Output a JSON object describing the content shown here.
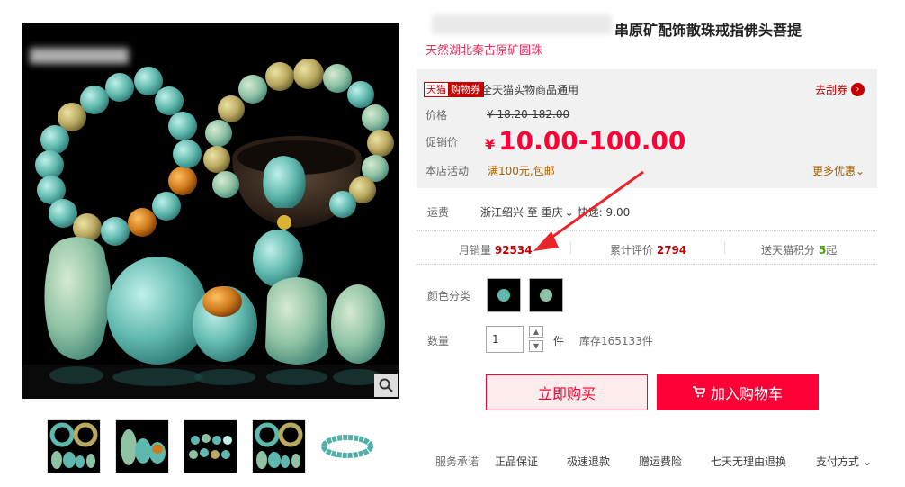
{
  "product": {
    "title": "串原矿配饰散珠戒指佛头菩提",
    "subtitle": "天然湖北秦古原矿圆珠",
    "image_watermark": "Y"
  },
  "coupon": {
    "tag_left": "天猫",
    "tag_right": "购物券",
    "text": "全天猫实物商品通用",
    "get_label": "去刮券"
  },
  "price": {
    "label": "价格",
    "original": "¥ 18.20-182.00",
    "promo_label": "促销价",
    "currency": "¥",
    "promo": "10.00-100.00"
  },
  "activity": {
    "label": "本店活动",
    "text": "满100元,包邮",
    "more_label": "更多优惠"
  },
  "shipping": {
    "label": "运费",
    "text": "浙江绍兴 至 重庆",
    "express": "快递: 9.00"
  },
  "stats": {
    "monthly_sales_label": "月销量",
    "monthly_sales": "92534",
    "reviews_label": "累计评价",
    "reviews": "2794",
    "points_label": "送天猫积分",
    "points": "5",
    "points_suffix": "起"
  },
  "color": {
    "label": "颜色分类"
  },
  "quantity": {
    "label": "数量",
    "value": "1",
    "unit": "件",
    "stock": "库存165133件"
  },
  "buttons": {
    "buy_now": "立即购买",
    "add_to_cart": "加入购物车"
  },
  "services": {
    "label": "服务承诺",
    "items": [
      "正品保证",
      "极速退款",
      "赠运费险",
      "七天无理由退换"
    ],
    "payment": "支付方式"
  },
  "colors": {
    "accent": "#ff0036",
    "dark_red": "#c40000",
    "turquoise": "#5fb8ad"
  }
}
